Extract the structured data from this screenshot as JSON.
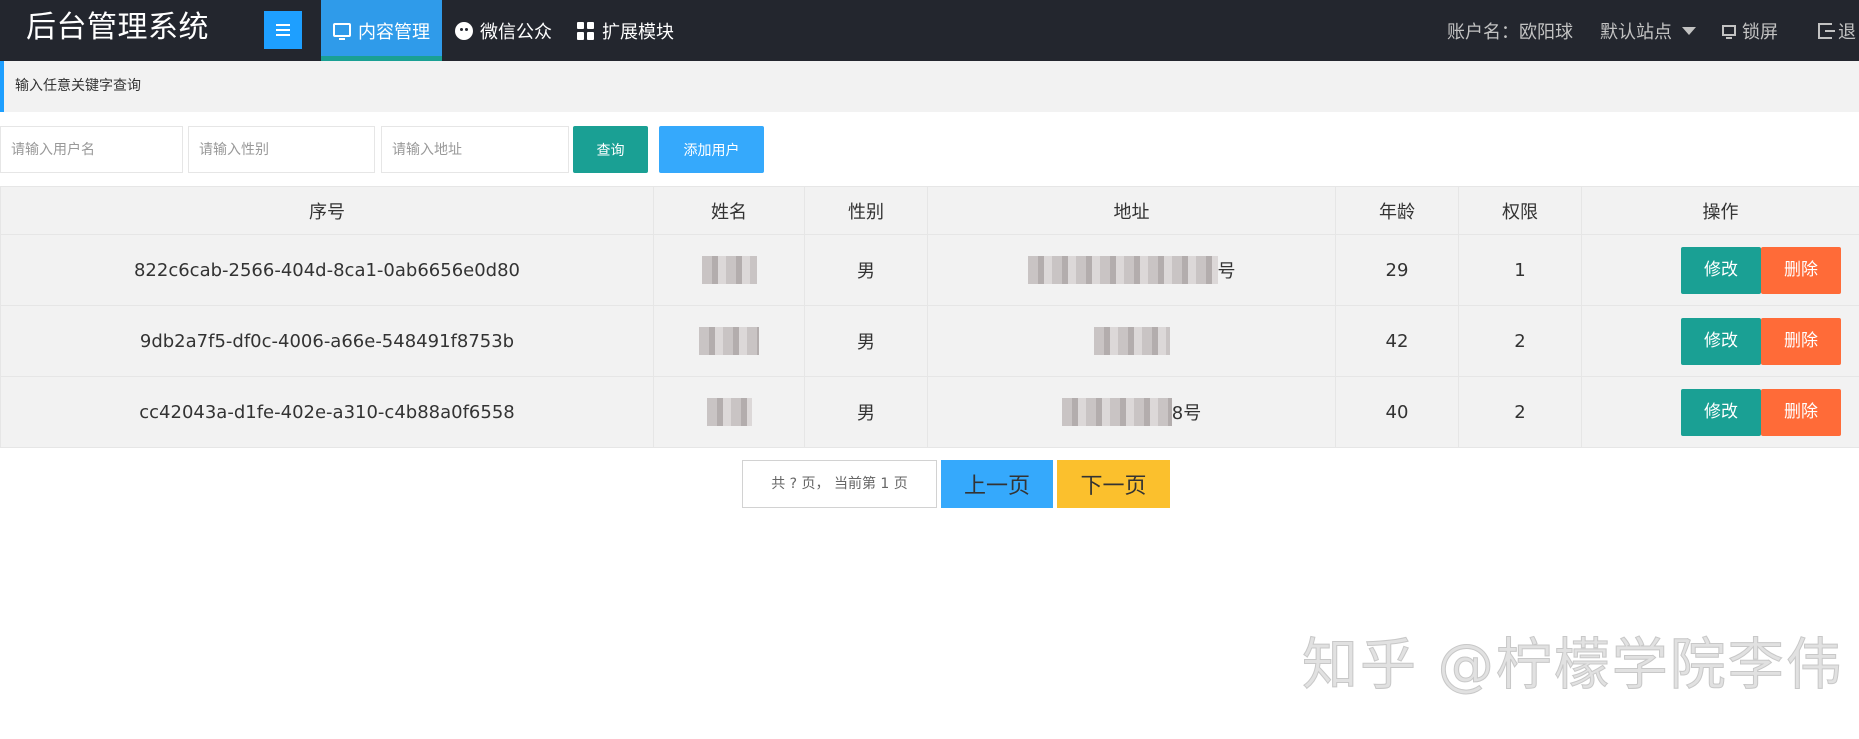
{
  "header": {
    "logo": "后台管理系统",
    "nav": [
      {
        "label": "内容管理",
        "icon": "monitor-icon"
      },
      {
        "label": "微信公众",
        "icon": "wechat-icon"
      },
      {
        "label": "扩展模块",
        "icon": "grid-icon"
      }
    ],
    "account": "账户名：欧阳球",
    "site": "默认站点",
    "lock": "锁屏",
    "logout": "退"
  },
  "quote": "输入任意关键字查询",
  "search": {
    "name_placeholder": "请输入用户名",
    "gender_placeholder": "请输入性别",
    "address_placeholder": "请输入地址",
    "query_label": "查询",
    "add_label": "添加用户"
  },
  "table": {
    "headers": [
      "序号",
      "姓名",
      "性别",
      "地址",
      "年龄",
      "权限",
      "操作"
    ],
    "rows": [
      {
        "id": "822c6cab-2566-404d-8ca1-0ab6656e0d80",
        "gender": "男",
        "address_tail": "号",
        "age": "29",
        "perm": "1"
      },
      {
        "id": "9db2a7f5-df0c-4006-a66e-548491f8753b",
        "gender": "男",
        "address_tail": "",
        "age": "42",
        "perm": "2"
      },
      {
        "id": "cc42043a-d1fe-402e-a310-c4b88a0f6558",
        "gender": "男",
        "address_tail": "8号",
        "age": "40",
        "perm": "2"
      }
    ],
    "edit_label": "修改",
    "delete_label": "删除"
  },
  "pagination": {
    "info": "共 ? 页， 当前第 1 页",
    "prev": "上一页",
    "next": "下一页"
  },
  "watermark": "知乎 @柠檬学院李伟",
  "colors": {
    "header_bg": "#23262e",
    "primary_blue": "#1e9fff",
    "teal": "#1aa094",
    "orange": "#ff6b38",
    "yellow": "#fbc02d"
  }
}
